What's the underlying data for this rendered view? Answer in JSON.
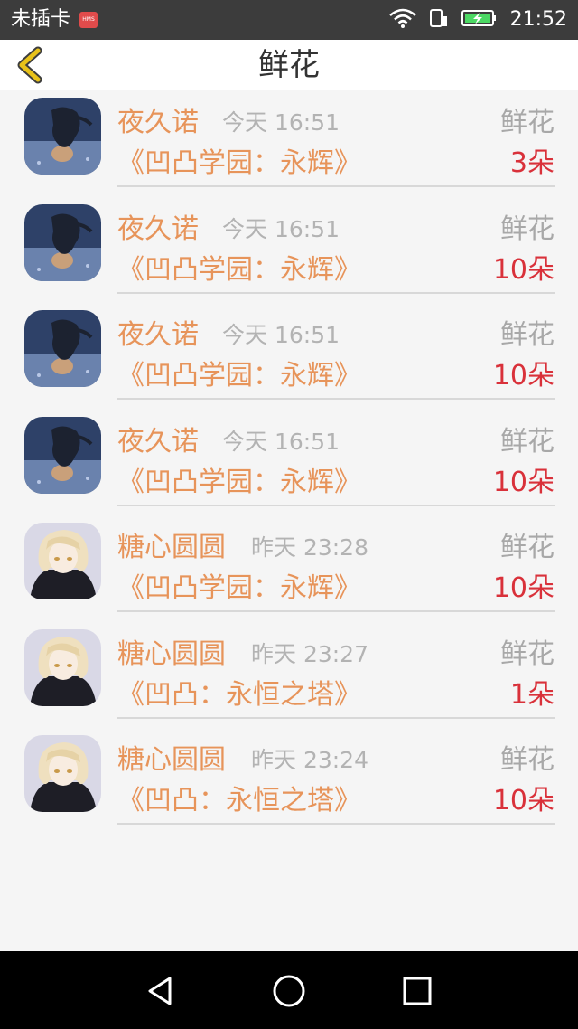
{
  "status_bar": {
    "carrier": "未插卡",
    "badge": "HMS",
    "time": "21:52",
    "icons": [
      "wifi-icon",
      "sim-icon",
      "battery-charging-icon"
    ]
  },
  "header": {
    "title": "鲜花",
    "back_icon": "chevron-left-icon"
  },
  "records": [
    {
      "name": "夜久诺",
      "time": "今天 16:51",
      "item": "鲜花",
      "book": "《凹凸学园：永辉》",
      "quantity": "3朵",
      "avatar": "night-figure"
    },
    {
      "name": "夜久诺",
      "time": "今天 16:51",
      "item": "鲜花",
      "book": "《凹凸学园：永辉》",
      "quantity": "10朵",
      "avatar": "night-figure"
    },
    {
      "name": "夜久诺",
      "time": "今天 16:51",
      "item": "鲜花",
      "book": "《凹凸学园：永辉》",
      "quantity": "10朵",
      "avatar": "night-figure"
    },
    {
      "name": "夜久诺",
      "time": "今天 16:51",
      "item": "鲜花",
      "book": "《凹凸学园：永辉》",
      "quantity": "10朵",
      "avatar": "night-figure"
    },
    {
      "name": "糖心圆圆",
      "time": "昨天 23:28",
      "item": "鲜花",
      "book": "《凹凸学园：永辉》",
      "quantity": "10朵",
      "avatar": "blonde-character"
    },
    {
      "name": "糖心圆圆",
      "time": "昨天 23:27",
      "item": "鲜花",
      "book": "《凹凸：永恒之塔》",
      "quantity": "1朵",
      "avatar": "blonde-character"
    },
    {
      "name": "糖心圆圆",
      "time": "昨天 23:24",
      "item": "鲜花",
      "book": "《凹凸：永恒之塔》",
      "quantity": "10朵",
      "avatar": "blonde-character"
    }
  ],
  "nav_bar": {
    "buttons": [
      "back-triangle-icon",
      "home-circle-icon",
      "recents-square-icon"
    ]
  },
  "colors": {
    "accent": "#e7945a",
    "quantity": "#d9313a",
    "muted": "#b3b3b3",
    "back_arrow": "#e8c21a"
  }
}
